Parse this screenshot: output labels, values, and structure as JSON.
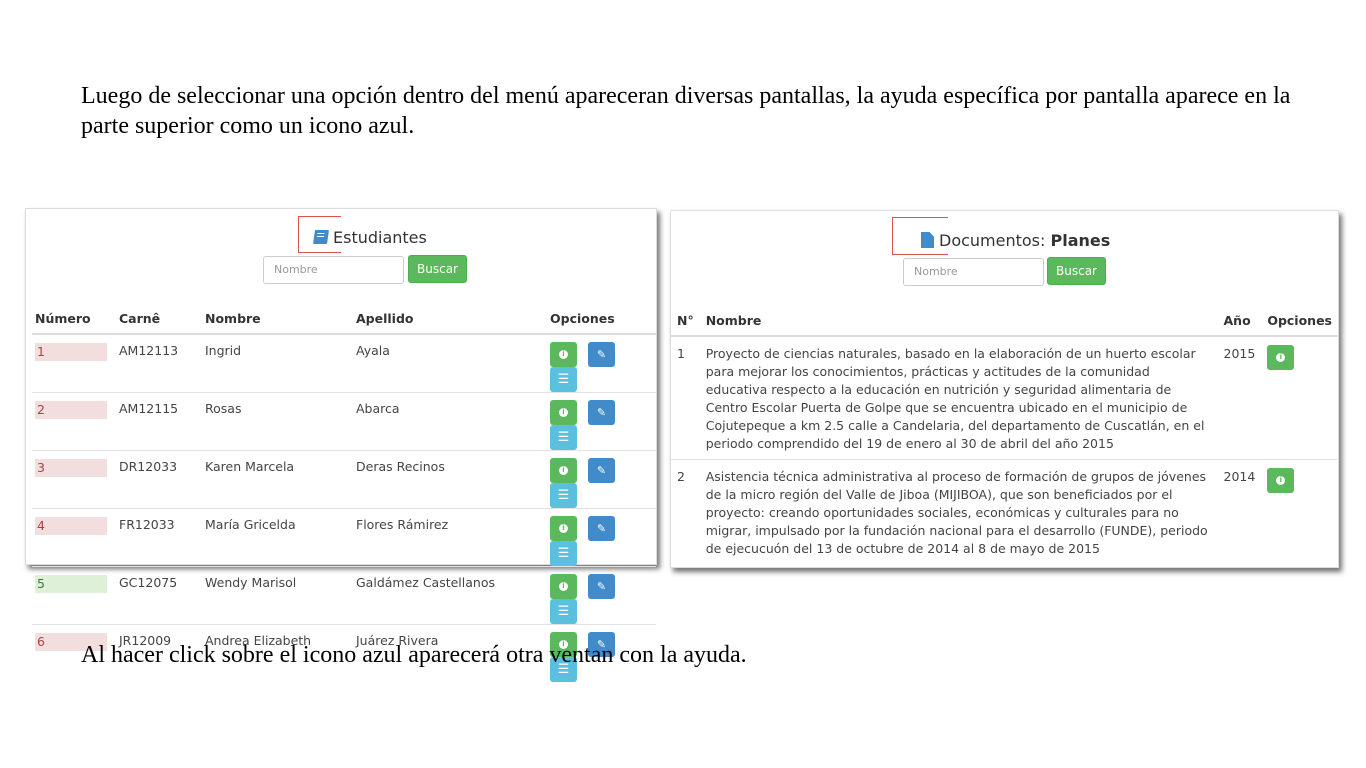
{
  "intro_text": "Luego de seleccionar una opción dentro del menú apareceran diversas pantallas, la ayuda específica por pantalla aparece en la parte superior como un icono azul.",
  "outro_text": "Al hacer click sobre el icono azul aparecerá otra ventan con la ayuda.",
  "students_panel": {
    "title": "Estudiantes",
    "search_placeholder": "Nombre",
    "search_button": "Buscar",
    "columns": [
      "Número",
      "Carnê",
      "Nombre",
      "Apellido",
      "Opciones"
    ],
    "rows": [
      {
        "numero": "1",
        "carne": "AM12113",
        "nombre": "Ingrid",
        "apellido": "Ayala",
        "status": "red"
      },
      {
        "numero": "2",
        "carne": "AM12115",
        "nombre": "Rosas",
        "apellido": "Abarca",
        "status": "red"
      },
      {
        "numero": "3",
        "carne": "DR12033",
        "nombre": "Karen Marcela",
        "apellido": "Deras Recinos",
        "status": "red"
      },
      {
        "numero": "4",
        "carne": "FR12033",
        "nombre": "María Gricelda",
        "apellido": "Flores Rámirez",
        "status": "red"
      },
      {
        "numero": "5",
        "carne": "GC12075",
        "nombre": "Wendy Marisol",
        "apellido": "Galdámez Castellanos",
        "status": "green"
      },
      {
        "numero": "6",
        "carne": "JR12009",
        "nombre": "Andrea Elizabeth",
        "apellido": "Juárez Rivera",
        "status": "red"
      }
    ]
  },
  "documents_panel": {
    "title_prefix": "Documentos:",
    "title_bold": "Planes",
    "search_placeholder": "Nombre",
    "search_button": "Buscar",
    "columns": [
      "N°",
      "Nombre",
      "Año",
      "Opciones"
    ],
    "rows": [
      {
        "n": "1",
        "nombre": "Proyecto de ciencias naturales, basado en la elaboración de un huerto escolar para mejorar los conocimientos, prácticas y actitudes de la comunidad educativa respecto a la educación en nutrición y seguridad alimentaria de Centro Escolar Puerta de Golpe que se encuentra ubicado en el municipio de Cojutepeque a km 2.5 calle a Candelaria, del departamento de Cuscatlán, en el periodo comprendido del 19 de enero al 30 de abril del año 2015",
        "anio": "2015"
      },
      {
        "n": "2",
        "nombre": "Asistencia técnica administrativa al proceso de formación de grupos de jóvenes de la micro región del Valle de Jiboa (MIJIBOA), que son beneficiados por el proyecto: creando oportunidades sociales, económicas y culturales para no migrar, impulsado por la fundación nacional para el desarrollo (FUNDE), periodo de ejecucuón del 13 de octubre de 2014 al 8 de mayo de 2015",
        "anio": "2014"
      }
    ]
  },
  "colors": {
    "help_icon": "#428bca",
    "success": "#5cb85c",
    "primary": "#428bca",
    "info": "#5bc0de",
    "highlight_border": "#d9534f"
  },
  "icons": {
    "students_help": "book-icon",
    "documents_help": "file-icon",
    "view": "info-circle-icon",
    "edit": "pencil-icon",
    "list": "list-icon"
  }
}
